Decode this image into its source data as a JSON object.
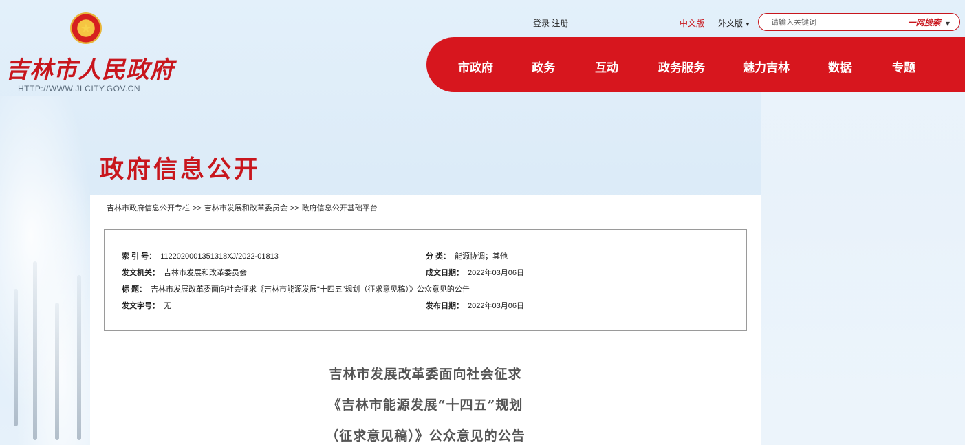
{
  "site": {
    "name": "吉林市人民政府",
    "url": "HTTP://WWW.JLCITY.GOV.CN"
  },
  "top_bar": {
    "login": "登录",
    "register": "注册",
    "lang_cn": "中文版",
    "lang_foreign": "外文版",
    "search_placeholder": "请输入关键词",
    "search_scope": "一网搜索"
  },
  "nav": {
    "items": [
      "市政府",
      "政务",
      "互动",
      "政务服务",
      "魅力吉林",
      "数据",
      "专题"
    ]
  },
  "section_title": "政府信息公开",
  "breadcrumb": {
    "items": [
      "吉林市政府信息公开专栏",
      "吉林市发展和改革委员会",
      "政府信息公开基础平台"
    ],
    "separator": ">>"
  },
  "meta": {
    "index_label": "索 引 号：",
    "index_value": "1122020001351318XJ/2022-01813",
    "category_label": "分    类：",
    "category_value": "能源协调；其他",
    "issuer_label": "发文机关：",
    "issuer_value": "吉林市发展和改革委员会",
    "created_label": "成文日期：",
    "created_value": "2022年03月06日",
    "title_label": "标    题：",
    "title_value": "吉林市发展改革委面向社会征求《吉林市能源发展“十四五”规划（征求意见稿）》公众意见的公告",
    "doc_no_label": "发文字号：",
    "doc_no_value": "无",
    "published_label": "发布日期：",
    "published_value": "2022年03月06日"
  },
  "article": {
    "title_line1": "吉林市发展改革委面向社会征求",
    "title_line2": "《吉林市能源发展“十四五”规划",
    "title_line3": "（征求意见稿）》公众意见的公告"
  },
  "colors": {
    "brand_red": "#d7161e",
    "background": "#e3f0fa"
  }
}
